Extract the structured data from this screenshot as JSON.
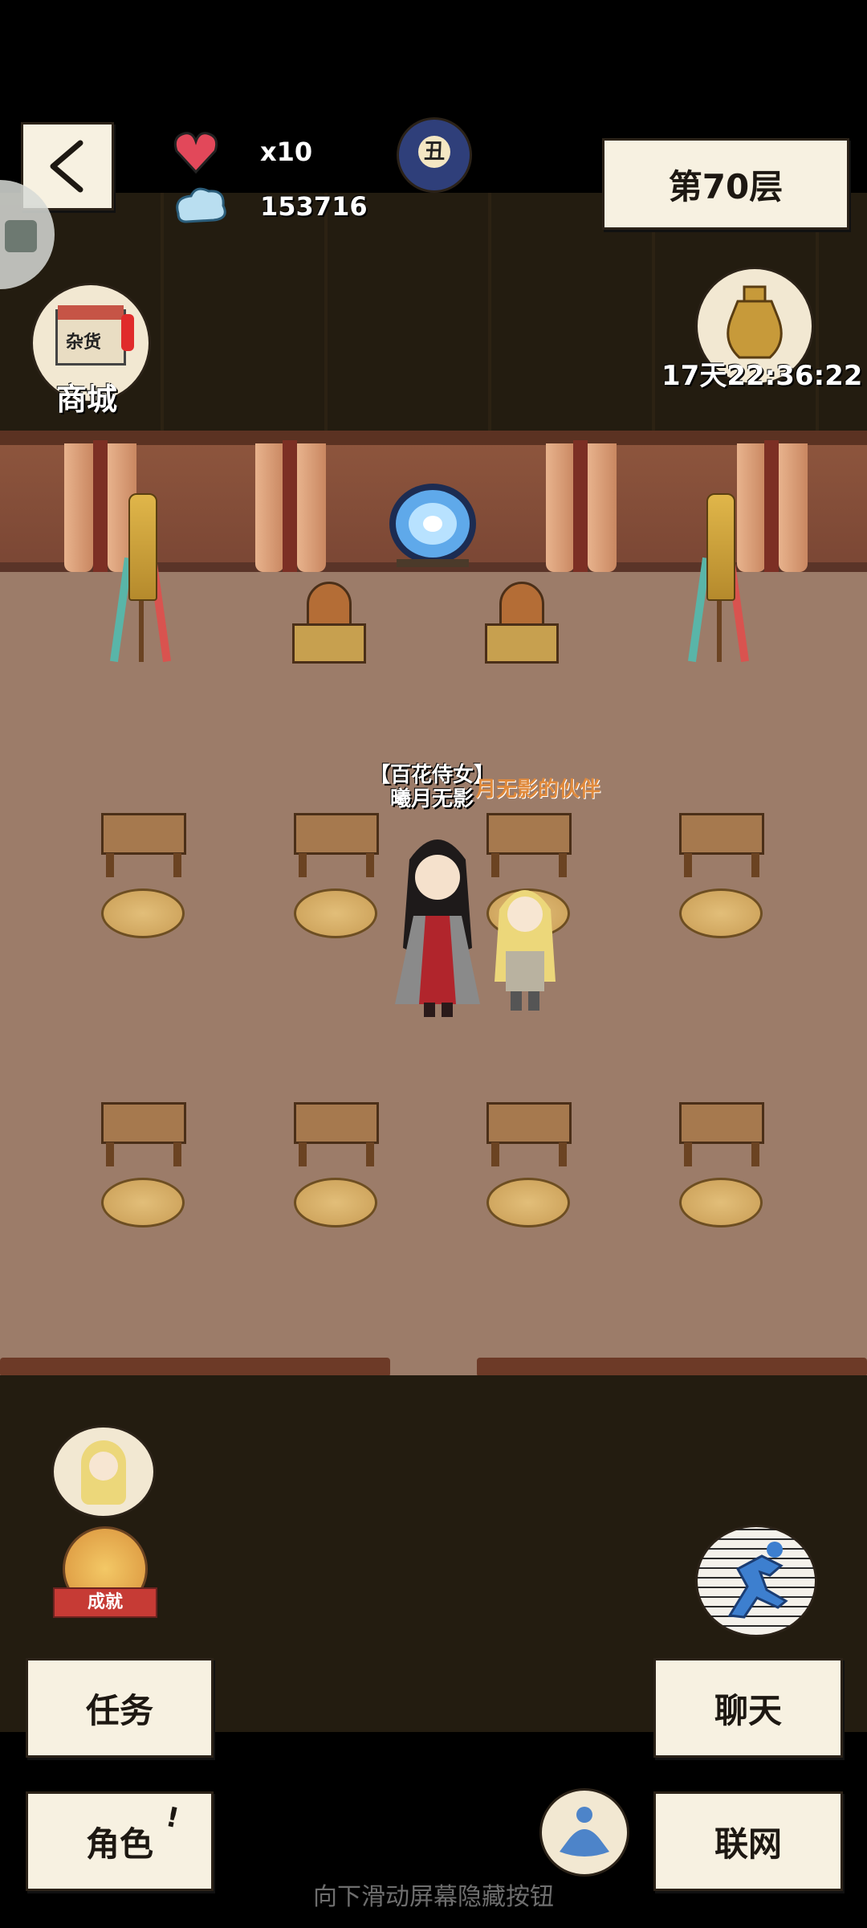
{
  "hud": {
    "lives_label": "x10",
    "currency": "153716",
    "zodiac_glyph": "丑",
    "floor_label": "第70层"
  },
  "left_side": {
    "shop_label": "商城",
    "shop_sign": "杂货"
  },
  "event": {
    "timer": "17天22:36:22"
  },
  "scene": {
    "npc_title": "【百花侍女】",
    "npc_name": "曦月无影",
    "partner_label": "月无影的伙伴"
  },
  "buttons": {
    "achievement_ribbon": "成就",
    "task": "任务",
    "character": "角色",
    "chat": "聊天",
    "network": "联网"
  },
  "footer": {
    "hint": "向下滑动屏幕隐藏按钮"
  },
  "colors": {
    "floor": "#9c7c69",
    "wall": "#7a4634",
    "dark": "#231c10",
    "paper": "#f7f1e1",
    "partner_label": "#e08a3c"
  }
}
